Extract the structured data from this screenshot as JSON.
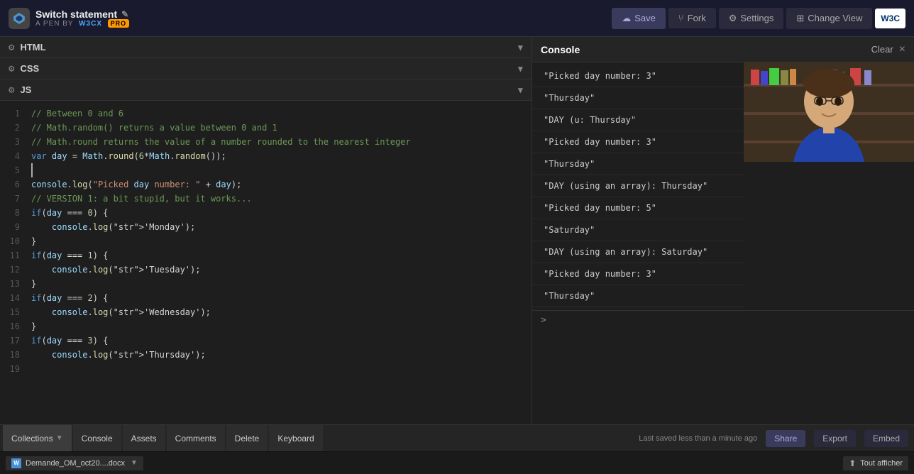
{
  "header": {
    "title": "Switch statement",
    "author_prefix": "A PEN BY",
    "author": "W3Cx",
    "pro_label": "PRO",
    "save_label": "Save",
    "fork_label": "Fork",
    "settings_label": "Settings",
    "change_view_label": "Change View",
    "w3c_label": "W3C"
  },
  "editor": {
    "html_label": "HTML",
    "css_label": "CSS",
    "js_label": "JS",
    "code_lines": [
      {
        "num": 1,
        "text": "// Between 0 and 6"
      },
      {
        "num": 2,
        "text": "// Math.random() returns a value between 0 and 1"
      },
      {
        "num": 3,
        "text": "// Math.round returns the value of a number rounded to the nearest integer"
      },
      {
        "num": 4,
        "text": "var day = Math.round(6*Math.random());"
      },
      {
        "num": 5,
        "text": ""
      },
      {
        "num": 6,
        "text": "console.log(\"Picked day number: \" + day);"
      },
      {
        "num": 7,
        "text": ""
      },
      {
        "num": 8,
        "text": "// VERSION 1: a bit stupid, but it works..."
      },
      {
        "num": 9,
        "text": "if(day === 0) {"
      },
      {
        "num": 10,
        "text": "    console.log('Monday');"
      },
      {
        "num": 11,
        "text": "}"
      },
      {
        "num": 12,
        "text": "if(day === 1) {"
      },
      {
        "num": 13,
        "text": "    console.log('Tuesday');"
      },
      {
        "num": 14,
        "text": "}"
      },
      {
        "num": 15,
        "text": "if(day === 2) {"
      },
      {
        "num": 16,
        "text": "    console.log('Wednesday');"
      },
      {
        "num": 17,
        "text": "}"
      },
      {
        "num": 18,
        "text": "if(day === 3) {"
      },
      {
        "num": 19,
        "text": "    console.log('Thursday');"
      }
    ]
  },
  "console": {
    "title": "Console",
    "clear_label": "Clear",
    "close_label": "×",
    "logs": [
      "\"Picked day number: 3\"",
      "\"Thursday\"",
      "\"DAY (u: Thursday\"",
      "\"Picked day number: 3\"",
      "\"Thursday\"",
      "\"DAY (using an array): Thursday\"",
      "\"Picked day number: 5\"",
      "\"Saturday\"",
      "\"DAY (using an array): Saturday\"",
      "\"Picked day number: 3\"",
      "\"Thursday\""
    ],
    "prompt": ">"
  },
  "bottom_bar": {
    "tabs": [
      {
        "label": "Collections",
        "has_arrow": true
      },
      {
        "label": "Console",
        "has_arrow": false
      },
      {
        "label": "Assets",
        "has_arrow": false
      },
      {
        "label": "Comments",
        "has_arrow": false
      },
      {
        "label": "Delete",
        "has_arrow": false
      },
      {
        "label": "Keyboard",
        "has_arrow": false
      }
    ],
    "status_text": "Last saved less than a minute ago",
    "share_label": "Share",
    "export_label": "Export",
    "embed_label": "Embed"
  },
  "taskbar": {
    "file_label": "Demande_OM_oct20....docx",
    "file_arrow": "▼",
    "tout_afficher_label": "Tout afficher"
  }
}
